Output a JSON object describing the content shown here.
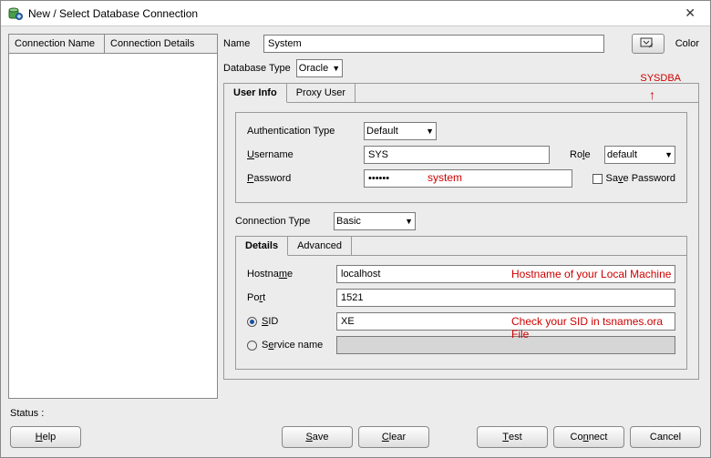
{
  "window": {
    "title": "New / Select Database Connection"
  },
  "leftPanel": {
    "col1": "Connection Name",
    "col2": "Connection Details"
  },
  "topRow": {
    "nameLabel": "Name",
    "nameValue": "System",
    "colorLabel": "Color"
  },
  "dbType": {
    "label": "Database Type",
    "value": "Oracle"
  },
  "tabs": {
    "userInfo": "User Info",
    "proxyUser": "Proxy User"
  },
  "auth": {
    "label": "Authentication Type",
    "value": "Default",
    "userLabelPre": "U",
    "userLabelRest": "sername",
    "userValue": "SYS",
    "passLabelPre": "P",
    "passLabelRest": "assword",
    "passValue": "••••••",
    "passHint": "system",
    "roleLabel": "Role",
    "roleValue": "default",
    "saveLabel": "Save Password",
    "sysdba": "SYSDBA"
  },
  "connType": {
    "label": "Connection Type",
    "value": "Basic"
  },
  "detTabs": {
    "details": "Details",
    "advanced": "Advanced"
  },
  "details": {
    "hostLabel": "Hostname",
    "hostValue": "localhost",
    "hostHint": "Hostname of your Local Machine",
    "portLabel": "Port",
    "portValue": "1521",
    "sidLabelPre": "S",
    "sidLabelRest": "ID",
    "sidValue": "XE",
    "sidHint": "Check your SID in tsnames.ora File",
    "serviceLabel": "Service name"
  },
  "status": {
    "label": "Status :"
  },
  "buttons": {
    "help": "Help",
    "save": "Save",
    "clear": "Clear",
    "test": "Test",
    "connect": "Connect",
    "cancel": "Cancel"
  }
}
